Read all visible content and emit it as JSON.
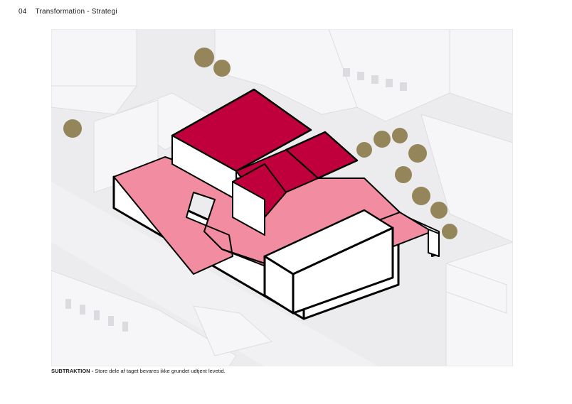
{
  "header": {
    "page_number": "04",
    "section_title": "Transformation - Strategi"
  },
  "figure": {
    "caption_label": "SUBTRAKTION -",
    "caption_text": "Store dele af taget bevares ikke grundet udtjent levetid."
  },
  "colors": {
    "roof_removed_dark": "#c0003c",
    "roof_removed_light": "#f28ca0",
    "context_buildings": "#f4f3f6",
    "ground": "#ecebee",
    "trees": "#8b7a4a"
  }
}
